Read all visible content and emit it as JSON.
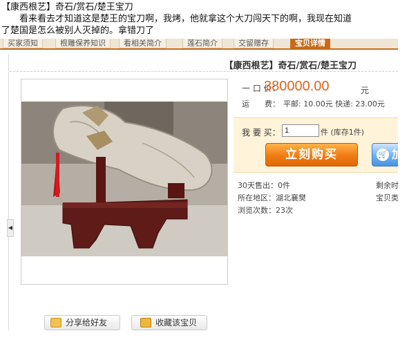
{
  "post": {
    "line1": "【康西根艺】奇石/赏石/楚王宝刀",
    "line2": "看来看去才知道这是楚王的宝刀啊，我烤，他就拿这个大刀闯天下的啊，我现在知道",
    "line3": "了楚国是怎么被别人灭掉的。拿错刀了"
  },
  "tabs": [
    "买家须知",
    "根雕保养知识",
    "看相关简介",
    "莲石简介",
    "交留赠存",
    "宝贝详情"
  ],
  "active_tab_index": 5,
  "product": {
    "title": "【康西根艺】奇石/赏石/楚王宝刀",
    "price_label": "一 口 价：",
    "price": "380000.00",
    "currency": "元",
    "shipping_label": "运　　费：",
    "shipping": "平邮: 10.00元 快递: 23.00元"
  },
  "purchase": {
    "qty_label": "我 要 买：",
    "qty_value": "1",
    "qty_unit": "件 (库存1件)",
    "buy_label": "立刻购买",
    "cart_label": "加",
    "cart_icon": "cart-icon"
  },
  "stats": {
    "sold_30d": "30天售出：0件",
    "location": "所在地区：湖北襄樊",
    "views": "浏览次数：23次",
    "remaining": "剩余时",
    "category": "宝贝类"
  },
  "actions": {
    "share": "分享给好友",
    "favorite": "收藏该宝贝"
  },
  "collapse_icon": "triangle-left-icon"
}
